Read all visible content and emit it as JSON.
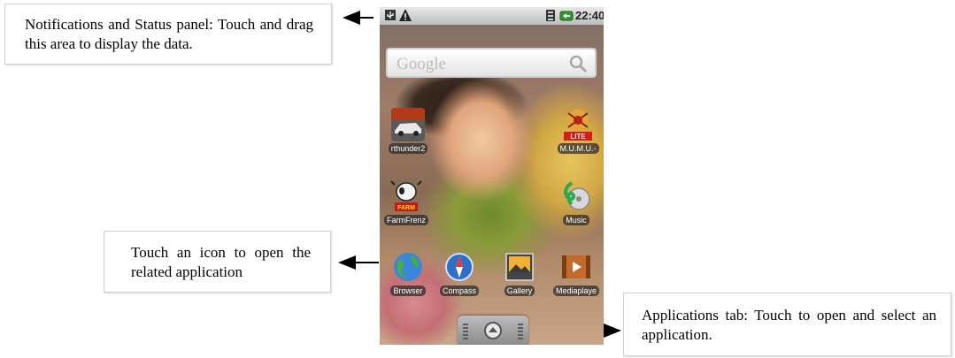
{
  "callouts": {
    "status_panel": "Notifications and Status panel: Touch and drag this area to display the data.",
    "icon_touch": "Touch an icon to open the related application",
    "apps_tab": "Applications tab: Touch to open and select an application."
  },
  "statusbar": {
    "time": "22:40",
    "icons": [
      "usb-icon",
      "warning-icon",
      "signal-icon",
      "battery-icon"
    ]
  },
  "search": {
    "logo_text": "Google",
    "icon": "search-icon"
  },
  "apps": {
    "rthunder": "rthunder2",
    "mumu": "M.U.M.U.-",
    "farmfrenzy": "FarmFrenz",
    "music": "Music",
    "browser": "Browser",
    "compass": "Compass",
    "gallery": "Gallery",
    "mediaplayer": "Mediaplaye"
  },
  "launcher": {
    "icon": "launcher-arrow-icon"
  },
  "colors": {
    "statusbar": "#d0d0d0",
    "label_bg": "#3a3a3a",
    "music": "#3bb05b",
    "lite_badge": "#d81b1b"
  }
}
